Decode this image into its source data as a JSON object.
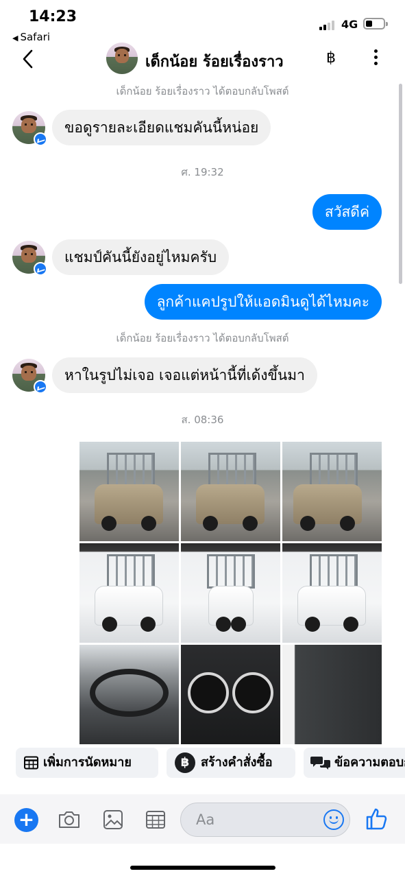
{
  "status_bar": {
    "time": "14:23",
    "back_app": "Safari",
    "network": "4G"
  },
  "header": {
    "contact_name": "เด็กน้อย ร้อยเรื่องราว",
    "baht_symbol": "฿"
  },
  "messages": [
    {
      "kind": "system",
      "text": "เด็กน้อย ร้อยเรื่องราว ได้ตอบกลับโพสต์"
    },
    {
      "kind": "incoming",
      "text": "ขอดูรายละเอียดแชมคันนี้หน่อย"
    },
    {
      "kind": "timestamp",
      "text": "ศ. 19:32"
    },
    {
      "kind": "outgoing",
      "text": "สวัสดีค่"
    },
    {
      "kind": "incoming",
      "text": "แชมป์คันนี้ยังอยู่ไหมครับ"
    },
    {
      "kind": "outgoing",
      "text": "ลูกค้าแคปรูปให้แอดมินดูได้ไหมคะ"
    },
    {
      "kind": "system",
      "text": "เด็กน้อย ร้อยเรื่องราว ได้ตอบกลับโพสต์"
    },
    {
      "kind": "incoming",
      "text": "หาในรูปไม่เจอ เจอแต่หน้านี้ที่เด้งขึ้นมา"
    },
    {
      "kind": "timestamp",
      "text": "ส. 08:36"
    }
  ],
  "quick_actions": [
    {
      "label": "เพิ่มการนัดหมาย",
      "icon": "calendar-icon"
    },
    {
      "label": "สร้างคำสั่งซื้อ",
      "icon": "baht-icon"
    },
    {
      "label": "ข้อความตอบกลับ",
      "icon": "chat-bubbles-icon"
    }
  ],
  "composer": {
    "placeholder": "Aa"
  },
  "colors": {
    "accent": "#1877f2",
    "outgoing_bubble": "#0084ff",
    "incoming_bubble": "#f0f0f0",
    "meta_text": "#8a8d91"
  }
}
